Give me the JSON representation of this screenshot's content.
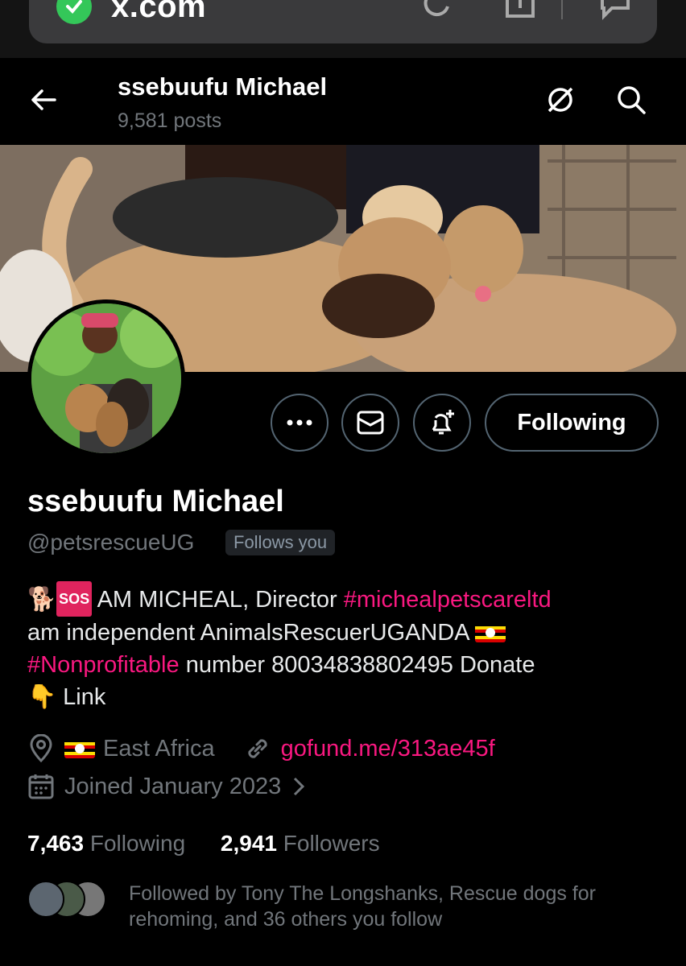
{
  "browser": {
    "url": "x.com"
  },
  "header": {
    "name": "ssebuufu Michael",
    "posts": "9,581 posts"
  },
  "actions": {
    "following_label": "Following"
  },
  "profile": {
    "display_name": "ssebuufu Michael",
    "handle": "@petsrescueUG",
    "follows_you": "Follows you",
    "bio": {
      "part1": "AM MICHEAL, Director ",
      "tag1": "#michealpetscareltd",
      "part2": "am independent AnimalsRescuerUGANDA ",
      "tag2": "#Nonprofitable",
      "part3": " number 80034838802495 Donate",
      "part4": " Link",
      "sos": "SOS"
    },
    "location": "East Africa",
    "website": "gofund.me/313ae45f",
    "joined": "Joined January 2023"
  },
  "stats": {
    "following_count": "7,463",
    "following_label": "Following",
    "followers_count": "2,941",
    "followers_label": "Followers"
  },
  "followed_by": "Followed by Tony The Longshanks, Rescue dogs for rehoming, and 36 others you follow",
  "colors": {
    "accent": "#f91880",
    "muted": "#71767b",
    "border": "#536471"
  }
}
